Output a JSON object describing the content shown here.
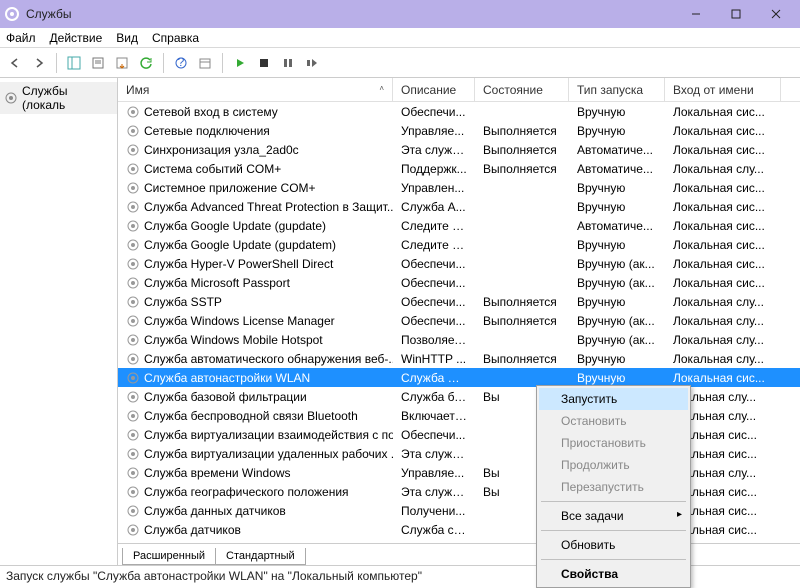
{
  "window": {
    "title": "Службы"
  },
  "menu": {
    "file": "Файл",
    "action": "Действие",
    "view": "Вид",
    "help": "Справка"
  },
  "tree": {
    "root": "Службы (локаль"
  },
  "columns": {
    "name": "Имя",
    "desc": "Описание",
    "state": "Состояние",
    "start": "Тип запуска",
    "logon": "Вход от имени"
  },
  "rows": [
    {
      "name": "Сетевой вход в систему",
      "desc": "Обеспечи...",
      "state": "",
      "start": "Вручную",
      "logon": "Локальная сис..."
    },
    {
      "name": "Сетевые подключения",
      "desc": "Управляе...",
      "state": "Выполняется",
      "start": "Вручную",
      "logon": "Локальная сис..."
    },
    {
      "name": "Синхронизация узла_2ad0c",
      "desc": "Эта служб...",
      "state": "Выполняется",
      "start": "Автоматиче...",
      "logon": "Локальная сис..."
    },
    {
      "name": "Система событий COM+",
      "desc": "Поддержк...",
      "state": "Выполняется",
      "start": "Автоматиче...",
      "logon": "Локальная слу..."
    },
    {
      "name": "Системное приложение COM+",
      "desc": "Управлен...",
      "state": "",
      "start": "Вручную",
      "logon": "Локальная сис..."
    },
    {
      "name": "Служба Advanced Threat Protection в Защит...",
      "desc": "Служба A...",
      "state": "",
      "start": "Вручную",
      "logon": "Локальная сис..."
    },
    {
      "name": "Служба Google Update (gupdate)",
      "desc": "Следите за...",
      "state": "",
      "start": "Автоматиче...",
      "logon": "Локальная сис..."
    },
    {
      "name": "Служба Google Update (gupdatem)",
      "desc": "Следите за...",
      "state": "",
      "start": "Вручную",
      "logon": "Локальная сис..."
    },
    {
      "name": "Служба Hyper-V PowerShell Direct",
      "desc": "Обеспечи...",
      "state": "",
      "start": "Вручную (ак...",
      "logon": "Локальная сис..."
    },
    {
      "name": "Служба Microsoft Passport",
      "desc": "Обеспечи...",
      "state": "",
      "start": "Вручную (ак...",
      "logon": "Локальная сис..."
    },
    {
      "name": "Служба SSTP",
      "desc": "Обеспечи...",
      "state": "Выполняется",
      "start": "Вручную",
      "logon": "Локальная слу..."
    },
    {
      "name": "Служба Windows License Manager",
      "desc": "Обеспечи...",
      "state": "Выполняется",
      "start": "Вручную (ак...",
      "logon": "Локальная слу..."
    },
    {
      "name": "Служба Windows Mobile Hotspot",
      "desc": "Позволяет...",
      "state": "",
      "start": "Вручную (ак...",
      "logon": "Локальная слу..."
    },
    {
      "name": "Служба автоматического обнаружения веб-...",
      "desc": "WinHTTP ...",
      "state": "Выполняется",
      "start": "Вручную",
      "logon": "Локальная слу..."
    },
    {
      "name": "Служба автонастройки WLAN",
      "desc": "Служба W...",
      "state": "",
      "start": "Вручную",
      "logon": "Локальная сис...",
      "selected": true
    },
    {
      "name": "Служба базовой фильтрации",
      "desc": "Служба ба...",
      "state": "Вы",
      "start": "",
      "logon": "окальная слу..."
    },
    {
      "name": "Служба беспроводной связи Bluetooth",
      "desc": "Включает ...",
      "state": "",
      "start": "",
      "logon": "окальная слу..."
    },
    {
      "name": "Служба виртуализации взаимодействия с по...",
      "desc": "Обеспечи...",
      "state": "",
      "start": "",
      "logon": "окальная сис..."
    },
    {
      "name": "Служба виртуализации удаленных рабочих ...",
      "desc": "Эта служб...",
      "state": "",
      "start": "",
      "logon": "окальная сис..."
    },
    {
      "name": "Служба времени Windows",
      "desc": "Управляе...",
      "state": "Вы",
      "start": "",
      "logon": "окальная слу..."
    },
    {
      "name": "Служба географического положения",
      "desc": "Эта служб...",
      "state": "Вы",
      "start": "",
      "logon": "окальная сис..."
    },
    {
      "name": "Служба данных датчиков",
      "desc": "Получени...",
      "state": "",
      "start": "",
      "logon": "окальная сис..."
    },
    {
      "name": "Служба датчиков",
      "desc": "Служба се...",
      "state": "",
      "start": "",
      "logon": "окальная сис..."
    }
  ],
  "tabs": {
    "extended": "Расширенный",
    "standard": "Стандартный"
  },
  "context": {
    "start": "Запустить",
    "stop": "Остановить",
    "pause": "Приостановить",
    "resume": "Продолжить",
    "restart": "Перезапустить",
    "alltasks": "Все задачи",
    "refresh": "Обновить",
    "props": "Свойства"
  },
  "status": "Запуск службы \"Служба автонастройки WLAN\" на \"Локальный компьютер\""
}
